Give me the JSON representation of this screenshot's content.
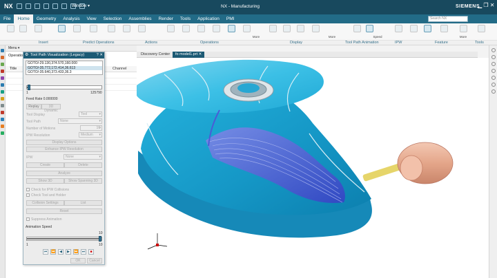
{
  "titlebar": {
    "logo": "NX",
    "window_menu": "Window ▾",
    "app_title": "NX - Manufacturing",
    "brand": "SIEMENS"
  },
  "menu": {
    "items": [
      "File",
      "Home",
      "Geometry",
      "Analysis",
      "View",
      "Selection",
      "Assemblies",
      "Render",
      "Tools",
      "Application",
      "PMI"
    ],
    "active": "Home"
  },
  "search": {
    "placeholder": "Search NX"
  },
  "ribbon": {
    "groups": [
      "Insert",
      "Predict Operations",
      "Actions",
      "Operations",
      "Display",
      "Tool Path Animation",
      "IPW",
      "Feature",
      "Tools"
    ],
    "more_label": "More",
    "speed_label": "Speed"
  },
  "navigator": {
    "menu_label": "Menu ▾",
    "header": "Operation",
    "title_col": "Title",
    "channel_col": "Channel"
  },
  "dialog": {
    "title": "Tool Path Visualization (Legacy)",
    "goto_lines": [
      "GOTO/-29.130,374.570,160.000",
      "GOTO/-35.772,172.414,36.613",
      "GOTO/-35.640,373.433,36.3"
    ],
    "slider_min": "1",
    "slider_max": "125790",
    "slider_position": 0.05,
    "feed_rate": "Feed Rate 0.000000",
    "tabs": [
      "Replay",
      "3D Dynamic"
    ],
    "tool_display_label": "Tool Display",
    "tool_display_value": "Tool",
    "tool_path_label": "Tool Path",
    "tool_path_value": "None",
    "num_motions_label": "Number of Motions",
    "num_motions_value": "10",
    "ipw_resolution_label": "IPW Resolution",
    "ipw_resolution_value": "Medium",
    "display_options": "Display Options",
    "enhance_ipw": "Enhance IPW Resolution",
    "ipw_label": "IPW",
    "ipw_value": "None",
    "create_btn": "Create",
    "delete_btn": "Delete",
    "analyze_btn": "Analyze",
    "show_3d_btn": "Show 3D",
    "show_spanning_btn": "Show Spanning 3D",
    "check_ipw": "Check for IPW Collisions",
    "check_tool": "Check Tool and Holder",
    "collision_settings": "Collision Settings",
    "list_btn": "List",
    "reset_btn": "Reset",
    "suppress_animation": "Suppress Animation",
    "animation_speed_label": "Animation Speed",
    "speed_min": "1",
    "speed_max": "10",
    "speed_value": 10,
    "transport": [
      "⏮",
      "⏪",
      "◀",
      "▶",
      "⏩",
      "⏭",
      "■"
    ],
    "ok": "OK",
    "cancel": "Cancel"
  },
  "viewport": {
    "tabs": [
      "Discovery Center",
      "fo model1.prt ✕"
    ],
    "active_tab": 1
  },
  "colors": {
    "titlebar": "#18495e",
    "menubar": "#226b87",
    "part_blue": "#1ea9d6",
    "part_light": "#8fd9f0",
    "toolpath_purple": "#4f5fd8",
    "holder_copper": "#e8b097",
    "tool_yellow": "#e6d56a"
  }
}
